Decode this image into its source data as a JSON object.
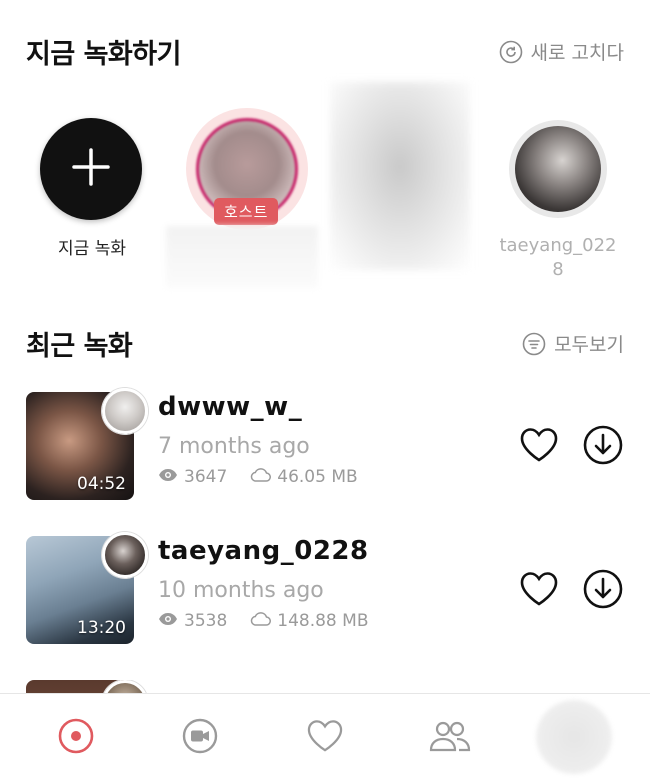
{
  "live_section": {
    "title": "지금 녹화하기",
    "refresh_label": "새로 고치다",
    "record_now_label": "지금 녹화",
    "host_badge": "호스트",
    "user_name": "taeyang_0228"
  },
  "recent_section": {
    "title": "최근 녹화",
    "view_all_label": "모두보기",
    "recordings": [
      {
        "name": "dwww_w_",
        "time_ago": "7 months ago",
        "views": "3647",
        "size": "46.05 MB",
        "duration": "04:52"
      },
      {
        "name": "taeyang_0228",
        "time_ago": "10 months ago",
        "views": "3538",
        "size": "148.88 MB",
        "duration": "13:20"
      }
    ]
  },
  "colors": {
    "accent_red": "#e05a5f",
    "host_ring": "#c7276b",
    "muted_text": "#a8a8a8"
  },
  "bottom_nav": {
    "items": [
      "record-tab",
      "video-tab",
      "likes-tab",
      "friends-tab",
      "profile-tab"
    ],
    "active": "record-tab"
  }
}
